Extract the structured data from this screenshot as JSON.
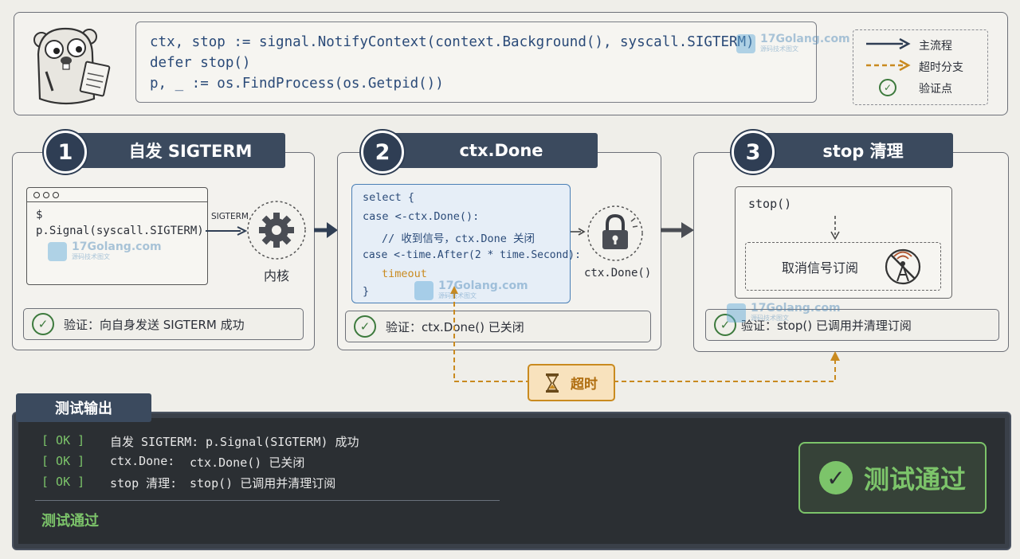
{
  "header_code": {
    "line1": "ctx, stop := signal.NotifyContext(context.Background(), syscall.SIGTERM)",
    "line2": "defer stop()",
    "line3": "p, _ := os.FindProcess(os.Getpid())"
  },
  "legend": {
    "main_flow": "主流程",
    "timeout_branch": "超时分支",
    "check_point": "验证点"
  },
  "step1": {
    "number": "1",
    "title": "自发 SIGTERM",
    "terminal_prompt": "$",
    "terminal_cmd": "p.Signal(syscall.SIGTERM)",
    "arrow_label": "SIGTERM",
    "kernel_label": "内核",
    "verify": "验证：向自身发送 SIGTERM 成功"
  },
  "step2": {
    "number": "2",
    "title": "ctx.Done",
    "code": {
      "l1": "select {",
      "l2": "case <-ctx.Done():",
      "l3": "// 收到信号，ctx.Done 关闭",
      "l4": "case <-time.After(2 * time.Second):",
      "l5": "timeout",
      "l6": "}"
    },
    "lock_label": "ctx.Done()",
    "verify": "验证：ctx.Done() 已关闭"
  },
  "step3": {
    "number": "3",
    "title": "stop 清理",
    "call": "stop()",
    "unsubscribe": "取消信号订阅",
    "verify": "验证：stop() 已调用并清理订阅"
  },
  "timeout_badge": "超时",
  "output": {
    "title": "测试输出",
    "lines": [
      {
        "status": "[ OK ]",
        "name": "自发 SIGTERM:",
        "detail": "p.Signal(SIGTERM) 成功"
      },
      {
        "status": "[ OK ]",
        "name": "ctx.Done:",
        "detail": "ctx.Done() 已关闭"
      },
      {
        "status": "[ OK ]",
        "name": "stop 清理:",
        "detail": "stop() 已调用并清理订阅"
      }
    ],
    "summary": "测试通过",
    "pass_stamp": "测试通过"
  },
  "watermark": {
    "site": "17Golang.com",
    "sub": "源码技术图文"
  },
  "colors": {
    "navy": "#3b4a5e",
    "orange": "#c98a1f",
    "green": "#3d7a3d",
    "term_bg": "#2b2f33",
    "ok_green": "#7cc46a"
  }
}
